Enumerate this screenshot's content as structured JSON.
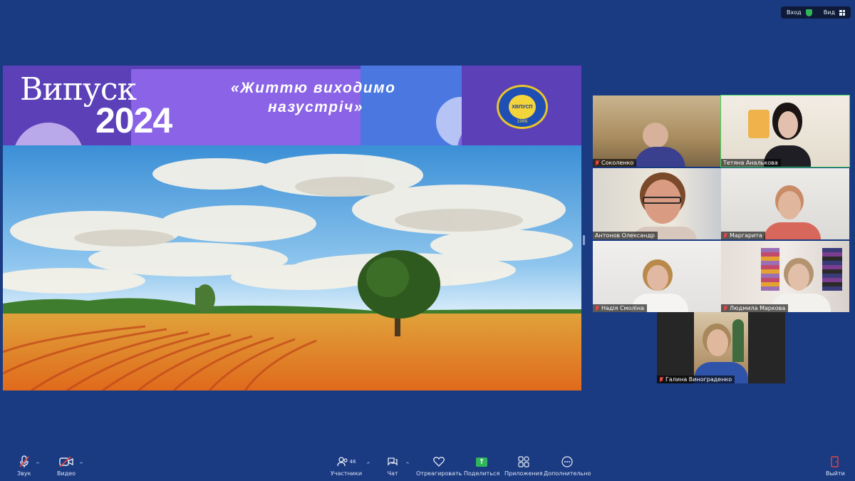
{
  "topbar": {
    "enter_label": "Вход",
    "view_label": "Вид"
  },
  "share": {
    "title_word": "Випуск",
    "title_year": "2024",
    "slogan_line1": "«Життю виходимо",
    "slogan_line2": "назустріч»",
    "emblem_text": "ХВПУСП",
    "emblem_year": "1966"
  },
  "participants": [
    {
      "name": "Соколенко",
      "muted": true
    },
    {
      "name": "Тетяна Аналькова",
      "muted": false,
      "active": true
    },
    {
      "name": "Антонов Олександр",
      "muted": false
    },
    {
      "name": "Маргарита",
      "muted": true
    },
    {
      "name": "Надія Смоліна",
      "muted": true
    },
    {
      "name": "Людмила Маркова",
      "muted": true
    },
    {
      "name": "Галина Винограденко",
      "muted": true
    }
  ],
  "toolbar": {
    "audio": "Звук",
    "video": "Видео",
    "participants": "Участники",
    "participants_count": "46",
    "chat": "Чат",
    "react": "Отреагировать",
    "share": "Поделиться",
    "apps": "Приложения",
    "more": "Дополнительно",
    "leave": "Выйти"
  },
  "colors": {
    "background": "#1a3a82",
    "active_border": "#39d15f",
    "muted": "#e54646"
  }
}
